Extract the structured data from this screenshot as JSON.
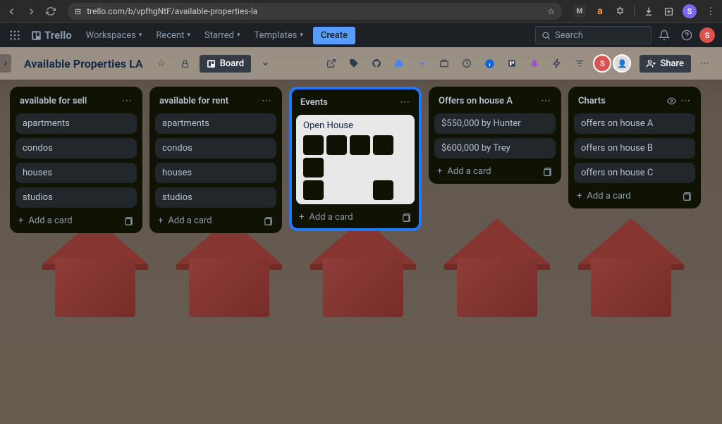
{
  "browser": {
    "url": "trello.com/b/vpfhgNtF/available-properties-la",
    "user_initial": "S"
  },
  "nav": {
    "app_name": "Trello",
    "workspaces": "Workspaces",
    "recent": "Recent",
    "starred": "Starred",
    "templates": "Templates",
    "create": "Create",
    "search_placeholder": "Search",
    "user_initial": "S"
  },
  "board": {
    "title": "Available Properties LA",
    "view_label": "Board",
    "share_label": "Share",
    "avatar_initial": "S"
  },
  "lists": [
    {
      "title": "available for sell",
      "highlighted": false,
      "eye": false,
      "cards": [
        {
          "label": "apartments"
        },
        {
          "label": "condos"
        },
        {
          "label": "houses"
        },
        {
          "label": "studios"
        }
      ],
      "add_label": "Add a card"
    },
    {
      "title": "available for rent",
      "highlighted": false,
      "eye": false,
      "cards": [
        {
          "label": "apartments"
        },
        {
          "label": "condos"
        },
        {
          "label": "houses"
        },
        {
          "label": "studios"
        }
      ],
      "add_label": "Add a card"
    },
    {
      "title": "Events",
      "highlighted": true,
      "eye": false,
      "cards": [
        {
          "label": "Open House",
          "image": true
        }
      ],
      "add_label": "Add a card"
    },
    {
      "title": "Offers on house A",
      "highlighted": false,
      "eye": false,
      "cards": [
        {
          "label": "$550,000 by Hunter"
        },
        {
          "label": "$600,000 by Trey"
        }
      ],
      "add_label": "Add a card"
    },
    {
      "title": "Charts",
      "highlighted": false,
      "eye": true,
      "cards": [
        {
          "label": "offers on house A"
        },
        {
          "label": "offers on house B"
        },
        {
          "label": "offers on house C"
        }
      ],
      "add_label": "Add a card"
    }
  ]
}
